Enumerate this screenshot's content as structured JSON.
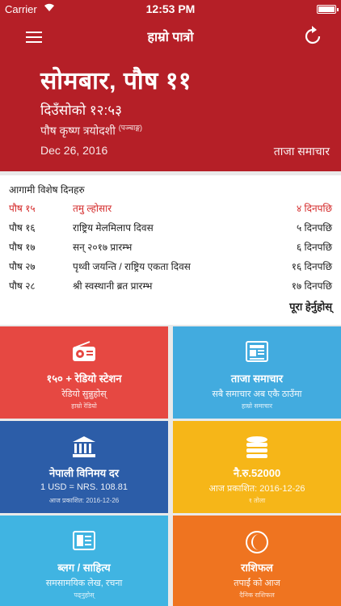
{
  "statusbar": {
    "carrier": "Carrier",
    "time": "12:53 PM"
  },
  "header": {
    "title": "हाम्रो पात्रो",
    "date_np": "सोमबार, पौष ११",
    "time_np": "दिउँसोको १२:५३",
    "tithi": "पौष कृष्ण त्रयोदशी",
    "tithi_sup": "(पञ्चाङ्ग)",
    "date_en": "Dec 26, 2016",
    "news_link": "ताजा समाचार"
  },
  "upcoming": {
    "title": "आगामी विशेष दिनहरु",
    "rows": [
      {
        "date": "पौष १५",
        "event": "तमु ल्होसार",
        "days": "४ दिनपछि",
        "highlight": true
      },
      {
        "date": "पौष १६",
        "event": "राष्ट्रिय मेलमिलाप दिवस",
        "days": "५ दिनपछि"
      },
      {
        "date": "पौष १७",
        "event": "सन् २०१७ प्रारम्भ",
        "days": "६ दिनपछि"
      },
      {
        "date": "पौष २७",
        "event": "पृथ्वी जयन्ति / राष्ट्रिय एकता दिवस",
        "days": "१६ दिनपछि"
      },
      {
        "date": "पौष २८",
        "event": "श्री स्वस्थानी ब्रत प्रारम्भ",
        "days": "१७ दिनपछि"
      }
    ],
    "view_all": "पूरा हेर्नुहोस्"
  },
  "tiles": [
    {
      "title": "१५० + रेडियो स्टेशन",
      "sub": "रेडियो सुन्नुहोस्",
      "sub2": "हाम्रो रेडियो",
      "icon": "radio-icon"
    },
    {
      "title": "ताजा समाचार",
      "sub": "सबै समाचार अब एकै ठाउँमा",
      "sub2": "हाम्रो समाचार",
      "icon": "newspaper-icon"
    },
    {
      "title": "नेपाली विनिमय दर",
      "sub": "1 USD = NRS. 108.81",
      "sub2": "आज प्रकाशित: 2016-12-26",
      "icon": "bank-icon"
    },
    {
      "title": "नै.रु.52000",
      "sub": "आज प्रकाशित: 2016-12-26",
      "sub2": "१ तोला",
      "icon": "gold-stack-icon"
    },
    {
      "title": "ब्लग / साहित्य",
      "sub": "समसामयिक लेख, रचना",
      "sub2": "पढ्नुहोस्",
      "icon": "blog-icon"
    },
    {
      "title": "राशिफल",
      "sub": "तपाईं को आज",
      "sub2": "दैनिक राशिफल",
      "icon": "moon-icon"
    }
  ],
  "colors": {
    "header": "#b51f27",
    "radio": "#e64842",
    "news": "#42abdf",
    "forex": "#2c5da8",
    "gold": "#f6b618",
    "blog": "#40b4e2",
    "rashifal": "#ef7420"
  }
}
